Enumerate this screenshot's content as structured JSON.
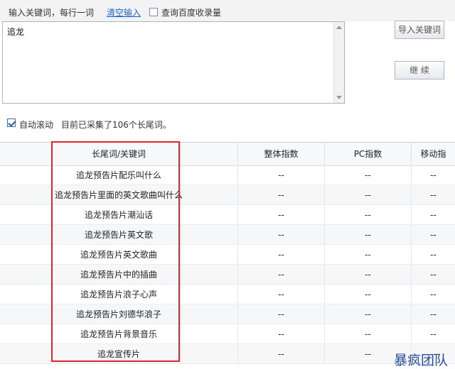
{
  "header": {
    "instruction": "输入关键词，每行一词",
    "clear_link": "清空输入",
    "baidu_checkbox_label": "查询百度收录量",
    "baidu_checked": false
  },
  "input": {
    "text": "追龙"
  },
  "buttons": {
    "import": "导入关键词",
    "continue": "继 续"
  },
  "status": {
    "autoscroll_label": "自动滚动",
    "autoscroll_checked": true,
    "count_text": "目前已采集了106个长尾词。"
  },
  "table": {
    "headers": [
      "长尾词/关键词",
      "整体指数",
      "PC指数",
      "移动指"
    ],
    "rows": [
      {
        "keyword": "追龙预告片配乐叫什么",
        "overall": "--",
        "pc": "--",
        "mobile": "--"
      },
      {
        "keyword": "追龙预告片里面的英文歌曲叫什么",
        "overall": "--",
        "pc": "--",
        "mobile": "--"
      },
      {
        "keyword": "追龙预告片潮汕话",
        "overall": "--",
        "pc": "--",
        "mobile": "--"
      },
      {
        "keyword": "追龙预告片英文歌",
        "overall": "--",
        "pc": "--",
        "mobile": "--"
      },
      {
        "keyword": "追龙预告片英文歌曲",
        "overall": "--",
        "pc": "--",
        "mobile": "--"
      },
      {
        "keyword": "追龙预告片中的插曲",
        "overall": "--",
        "pc": "--",
        "mobile": "--"
      },
      {
        "keyword": "追龙预告片浪子心声",
        "overall": "--",
        "pc": "--",
        "mobile": "--"
      },
      {
        "keyword": "追龙预告片刘德华浪子",
        "overall": "--",
        "pc": "--",
        "mobile": "--"
      },
      {
        "keyword": "追龙预告片背景音乐",
        "overall": "--",
        "pc": "--",
        "mobile": "--"
      },
      {
        "keyword": "追龙宣传片",
        "overall": "--",
        "pc": "--",
        "mobile": "--"
      }
    ]
  },
  "watermark": "暴疯团队",
  "colors": {
    "link": "#1a66d0",
    "highlight_box": "#e0242a",
    "watermark": "#2c4a9a"
  }
}
